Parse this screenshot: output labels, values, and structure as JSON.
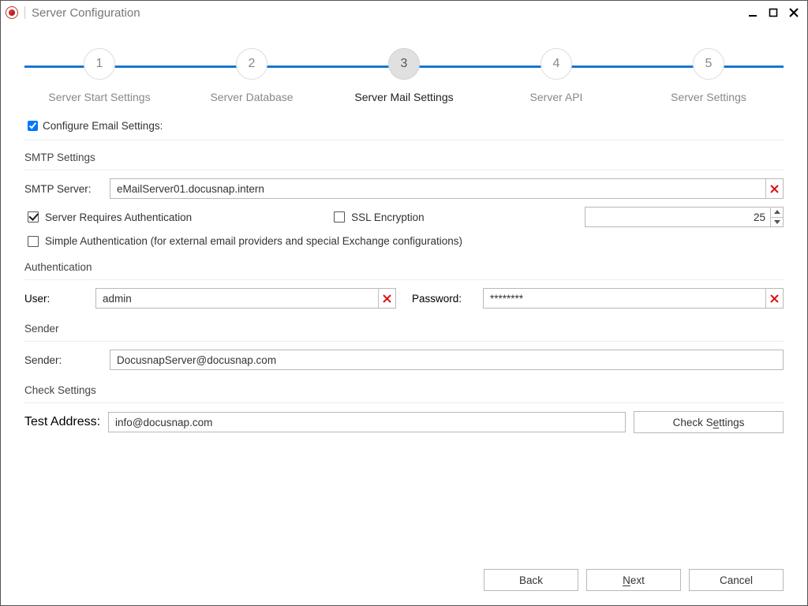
{
  "window": {
    "title": "Server Configuration"
  },
  "steps": [
    {
      "num": "1",
      "label": "Server Start Settings"
    },
    {
      "num": "2",
      "label": "Server Database"
    },
    {
      "num": "3",
      "label": "Server Mail Settings"
    },
    {
      "num": "4",
      "label": "Server API"
    },
    {
      "num": "5",
      "label": "Server Settings"
    }
  ],
  "active_step_index": 2,
  "configure_label": "Configure Email Settings:",
  "configure_checked": true,
  "sections": {
    "smtp_title": "SMTP Settings",
    "auth_title": "Authentication",
    "sender_title": "Sender",
    "check_title": "Check Settings"
  },
  "smtp": {
    "server_label": "SMTP Server:",
    "server_value": "eMailServer01.docusnap.intern",
    "requires_auth_label": "Server Requires Authentication",
    "requires_auth_checked": true,
    "ssl_label": "SSL Encryption",
    "ssl_checked": false,
    "port_value": "25",
    "simple_auth_label": "Simple Authentication (for external email providers and special Exchange configurations)",
    "simple_auth_checked": false
  },
  "auth": {
    "user_label": "User:",
    "user_value": "admin",
    "password_label": "Password:",
    "password_value": "********"
  },
  "sender": {
    "label": "Sender:",
    "value": "DocusnapServer@docusnap.com"
  },
  "check": {
    "label": "Test Address:",
    "value": "info@docusnap.com",
    "button_prefix": "Check S",
    "button_ul": "e",
    "button_suffix": "ttings"
  },
  "footer": {
    "back": "Back",
    "next_ul": "N",
    "next_rest": "ext",
    "cancel": "Cancel"
  }
}
